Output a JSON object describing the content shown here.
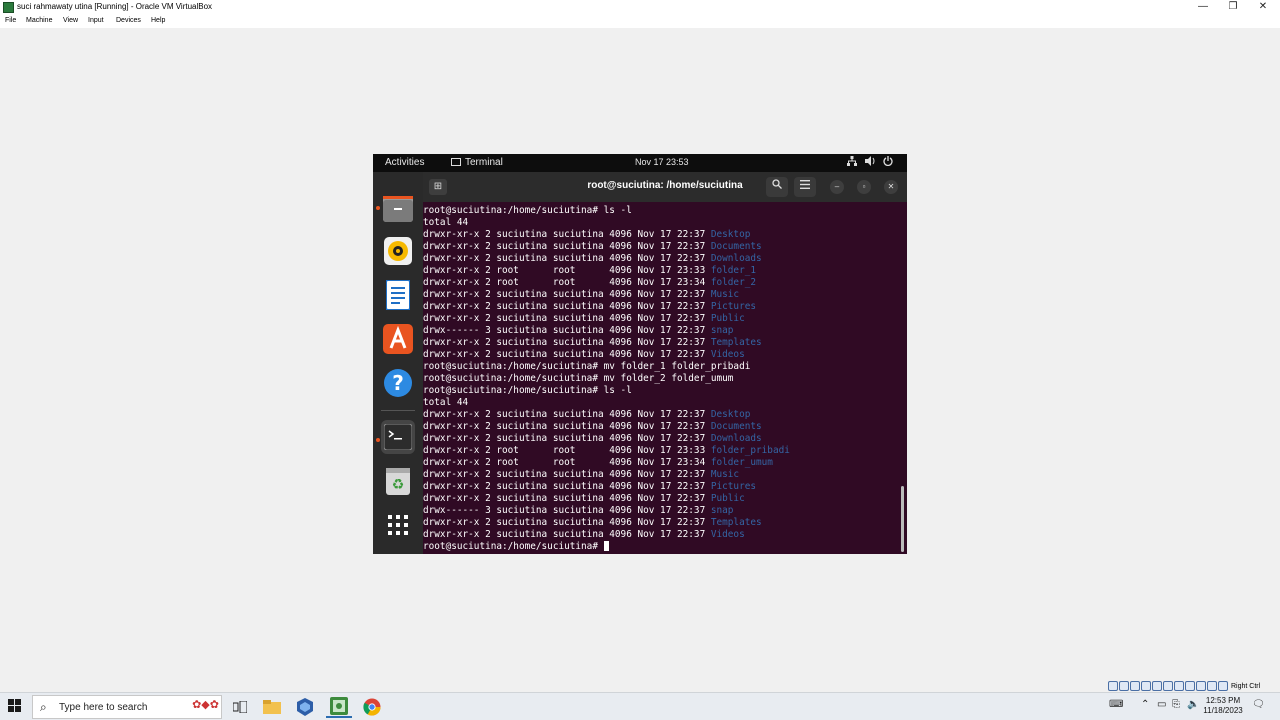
{
  "vbox": {
    "title": "suci rahmawaty utina [Running] - Oracle VM VirtualBox",
    "menu": [
      "File",
      "Machine",
      "View",
      "Input",
      "Devices",
      "Help"
    ],
    "window_controls": {
      "minimize": "—",
      "restore": "❐",
      "close": "✕"
    },
    "host_key": "Right Ctrl"
  },
  "ubuntu": {
    "topbar": {
      "activities": "Activities",
      "app_name": "Terminal",
      "clock": "Nov 17  23:53"
    },
    "dock": [
      "files-icon",
      "rhythmbox-icon",
      "writer-icon",
      "app-center-icon",
      "help-icon",
      "terminal-icon",
      "trash-icon",
      "show-apps-icon"
    ],
    "terminal": {
      "title": "root@suciutina: /home/suciutina",
      "lines": [
        {
          "text": "root@suciutina:/home/suciutina# ls -l",
          "name": ""
        },
        {
          "text": "total 44",
          "name": ""
        },
        {
          "text": "drwxr-xr-x 2 suciutina suciutina 4096 Nov 17 22:37 ",
          "name": "Desktop"
        },
        {
          "text": "drwxr-xr-x 2 suciutina suciutina 4096 Nov 17 22:37 ",
          "name": "Documents"
        },
        {
          "text": "drwxr-xr-x 2 suciutina suciutina 4096 Nov 17 22:37 ",
          "name": "Downloads"
        },
        {
          "text": "drwxr-xr-x 2 root      root      4096 Nov 17 23:33 ",
          "name": "folder_1"
        },
        {
          "text": "drwxr-xr-x 2 root      root      4096 Nov 17 23:34 ",
          "name": "folder_2"
        },
        {
          "text": "drwxr-xr-x 2 suciutina suciutina 4096 Nov 17 22:37 ",
          "name": "Music"
        },
        {
          "text": "drwxr-xr-x 2 suciutina suciutina 4096 Nov 17 22:37 ",
          "name": "Pictures"
        },
        {
          "text": "drwxr-xr-x 2 suciutina suciutina 4096 Nov 17 22:37 ",
          "name": "Public"
        },
        {
          "text": "drwx------ 3 suciutina suciutina 4096 Nov 17 22:37 ",
          "name": "snap"
        },
        {
          "text": "drwxr-xr-x 2 suciutina suciutina 4096 Nov 17 22:37 ",
          "name": "Templates"
        },
        {
          "text": "drwxr-xr-x 2 suciutina suciutina 4096 Nov 17 22:37 ",
          "name": "Videos"
        },
        {
          "text": "root@suciutina:/home/suciutina# mv folder_1 folder_pribadi",
          "name": ""
        },
        {
          "text": "root@suciutina:/home/suciutina# mv folder_2 folder_umum",
          "name": ""
        },
        {
          "text": "root@suciutina:/home/suciutina# ls -l",
          "name": ""
        },
        {
          "text": "total 44",
          "name": ""
        },
        {
          "text": "drwxr-xr-x 2 suciutina suciutina 4096 Nov 17 22:37 ",
          "name": "Desktop"
        },
        {
          "text": "drwxr-xr-x 2 suciutina suciutina 4096 Nov 17 22:37 ",
          "name": "Documents"
        },
        {
          "text": "drwxr-xr-x 2 suciutina suciutina 4096 Nov 17 22:37 ",
          "name": "Downloads"
        },
        {
          "text": "drwxr-xr-x 2 root      root      4096 Nov 17 23:33 ",
          "name": "folder_pribadi"
        },
        {
          "text": "drwxr-xr-x 2 root      root      4096 Nov 17 23:34 ",
          "name": "folder_umum"
        },
        {
          "text": "drwxr-xr-x 2 suciutina suciutina 4096 Nov 17 22:37 ",
          "name": "Music"
        },
        {
          "text": "drwxr-xr-x 2 suciutina suciutina 4096 Nov 17 22:37 ",
          "name": "Pictures"
        },
        {
          "text": "drwxr-xr-x 2 suciutina suciutina 4096 Nov 17 22:37 ",
          "name": "Public"
        },
        {
          "text": "drwx------ 3 suciutina suciutina 4096 Nov 17 22:37 ",
          "name": "snap"
        },
        {
          "text": "drwxr-xr-x 2 suciutina suciutina 4096 Nov 17 22:37 ",
          "name": "Templates"
        },
        {
          "text": "drwxr-xr-x 2 suciutina suciutina 4096 Nov 17 22:37 ",
          "name": "Videos"
        }
      ],
      "prompt": "root@suciutina:/home/suciutina# "
    }
  },
  "windows": {
    "search_placeholder": "Type here to search",
    "clock_time": "12:53 PM",
    "clock_date": "11/18/2023"
  },
  "colors": {
    "terminal_bg": "#300a24",
    "dir_name": "#3465a4",
    "ubuntu_orange": "#e95420"
  }
}
